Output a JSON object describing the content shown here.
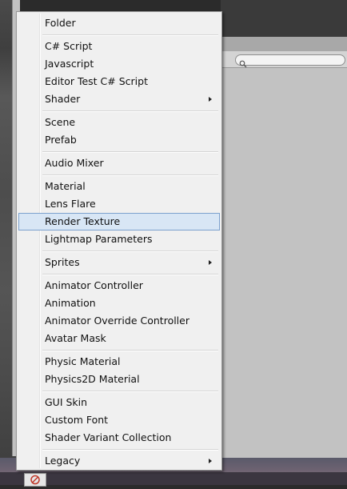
{
  "menu": {
    "groups": [
      {
        "items": [
          {
            "label": "Folder",
            "submenu": false
          }
        ]
      },
      {
        "items": [
          {
            "label": "C# Script",
            "submenu": false
          },
          {
            "label": "Javascript",
            "submenu": false
          },
          {
            "label": "Editor Test C# Script",
            "submenu": false
          },
          {
            "label": "Shader",
            "submenu": true
          }
        ]
      },
      {
        "items": [
          {
            "label": "Scene",
            "submenu": false
          },
          {
            "label": "Prefab",
            "submenu": false
          }
        ]
      },
      {
        "items": [
          {
            "label": "Audio Mixer",
            "submenu": false
          }
        ]
      },
      {
        "items": [
          {
            "label": "Material",
            "submenu": false
          },
          {
            "label": "Lens Flare",
            "submenu": false
          },
          {
            "label": "Render Texture",
            "submenu": false,
            "highlighted": true
          },
          {
            "label": "Lightmap Parameters",
            "submenu": false
          }
        ]
      },
      {
        "items": [
          {
            "label": "Sprites",
            "submenu": true
          }
        ]
      },
      {
        "items": [
          {
            "label": "Animator Controller",
            "submenu": false
          },
          {
            "label": "Animation",
            "submenu": false
          },
          {
            "label": "Animator Override Controller",
            "submenu": false
          },
          {
            "label": "Avatar Mask",
            "submenu": false
          }
        ]
      },
      {
        "items": [
          {
            "label": "Physic Material",
            "submenu": false
          },
          {
            "label": "Physics2D Material",
            "submenu": false
          }
        ]
      },
      {
        "items": [
          {
            "label": "GUI Skin",
            "submenu": false
          },
          {
            "label": "Custom Font",
            "submenu": false
          },
          {
            "label": "Shader Variant Collection",
            "submenu": false
          }
        ]
      },
      {
        "items": [
          {
            "label": "Legacy",
            "submenu": true
          }
        ]
      }
    ]
  },
  "search": {
    "icon": "search-icon"
  },
  "colors": {
    "menu_bg": "#f0f0f0",
    "highlight_bg": "#d8e6f5",
    "highlight_border": "#7da2ce"
  }
}
